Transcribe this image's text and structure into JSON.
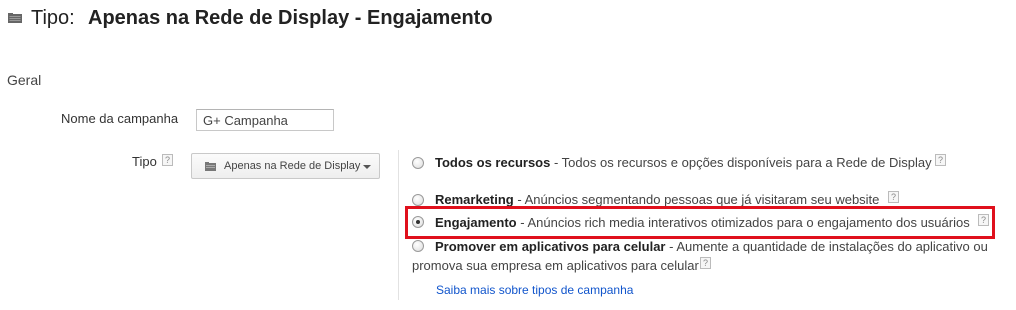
{
  "header": {
    "type_label": "Tipo:",
    "campaign_type": "Apenas na Rede de Display - Engajamento"
  },
  "section_title": "Geral",
  "campaign_name": {
    "label": "Nome da campanha",
    "value": "G+ Campanha"
  },
  "type_field": {
    "label": "Tipo",
    "help": "?",
    "dropdown_value": "Apenas na Rede de Display"
  },
  "options": [
    {
      "title": "Todos os recursos",
      "description": " - Todos os recursos e opções disponíveis para a Rede de Display",
      "selected": false
    },
    {
      "title": "Remarketing",
      "description": " - Anúncios segmentando pessoas que já visitaram seu website",
      "selected": false
    },
    {
      "title": "Engajamento",
      "description": " - Anúncios rich media interativos otimizados para o engajamento dos usuários",
      "selected": true
    },
    {
      "title": "Promover em aplicativos para celular",
      "description": " - Aumente a quantidade de instalações do aplicativo ou",
      "description_line2": "promova sua empresa em aplicativos para celular",
      "selected": false
    }
  ],
  "help_glyph": "?",
  "learn_more_link": "Saiba mais sobre tipos de campanha",
  "colors": {
    "highlight_border": "#e0101c",
    "link": "#1155cc"
  }
}
